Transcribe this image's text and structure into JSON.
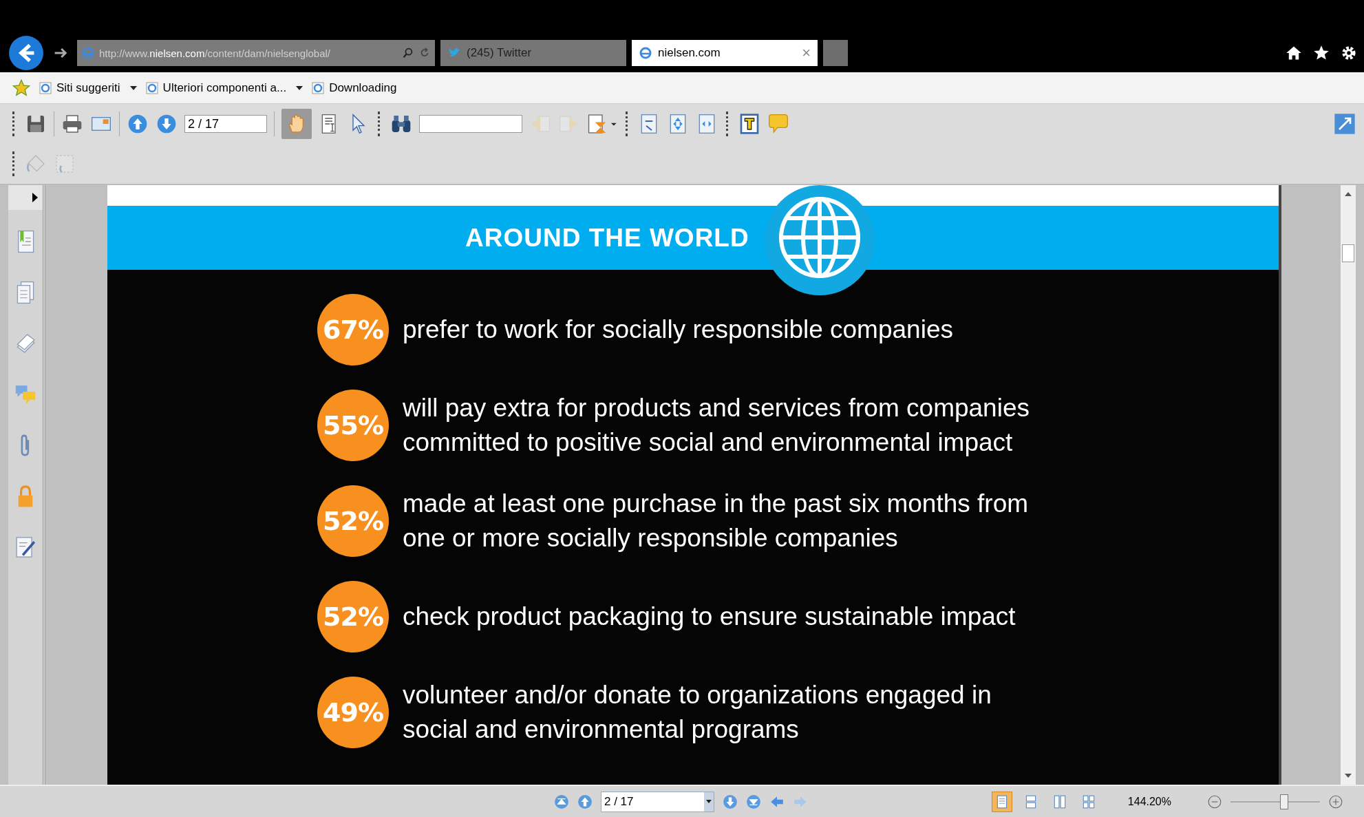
{
  "browser": {
    "url_prefix": "http://www.",
    "url_domain": "nielsen.com",
    "url_rest": "/content/dam/nielsenglobal/",
    "tabs": [
      {
        "label": "(245) Twitter",
        "selected": false
      },
      {
        "label": "nielsen.com",
        "selected": true,
        "close": "×"
      }
    ]
  },
  "favorites": [
    {
      "label": "Siti suggeriti",
      "dropdown": true
    },
    {
      "label": "Ulteriori componenti a...",
      "dropdown": true
    },
    {
      "label": "Downloading",
      "dropdown": false
    }
  ],
  "pdf_toolbar": {
    "page_field": "2 / 17",
    "hand_tool_selected": true
  },
  "document": {
    "title": "AROUND THE WORLD",
    "stats": [
      {
        "percent": "67%",
        "text": "prefer to work for socially responsible companies"
      },
      {
        "percent": "55%",
        "text": "will pay extra for products and services from companies committed to positive social and environmental impact"
      },
      {
        "percent": "52%",
        "text": "made at least one purchase in the past six months from one or more socially responsible companies"
      },
      {
        "percent": "52%",
        "text": "check product packaging to ensure sustainable impact"
      },
      {
        "percent": "49%",
        "text": "volunteer and/or donate to organizations engaged in social and environmental programs"
      }
    ]
  },
  "status_bar": {
    "page_field": "2 / 17",
    "zoom": "144.20%",
    "level": 0.6,
    "view_modes": [
      {
        "kind": "single",
        "selected": true
      },
      {
        "kind": "continuous",
        "selected": false
      },
      {
        "kind": "facing",
        "selected": false
      },
      {
        "kind": "grid",
        "selected": false
      }
    ]
  }
}
